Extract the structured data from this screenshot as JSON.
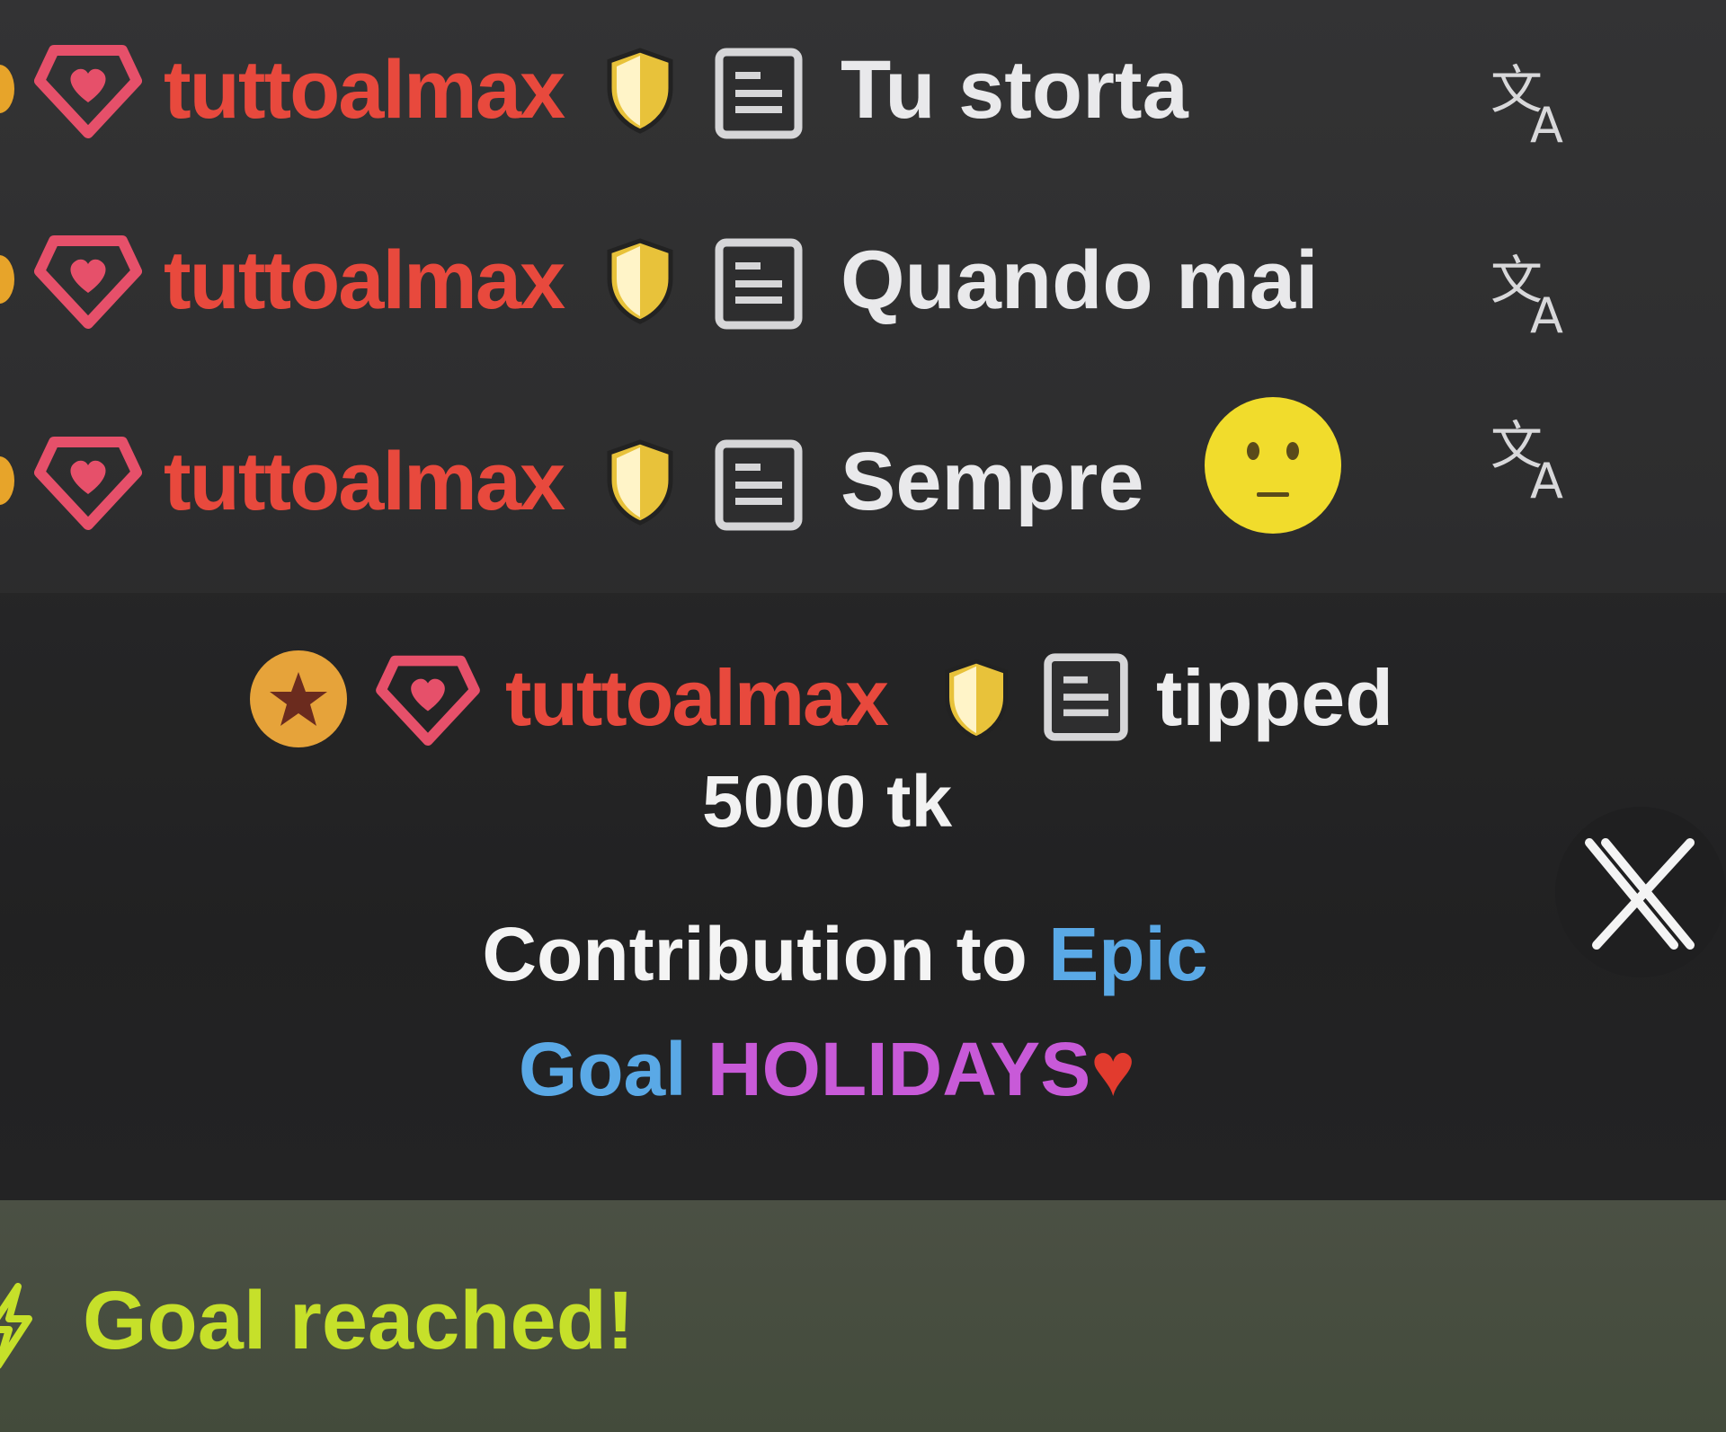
{
  "chat": {
    "messages": [
      {
        "username": "tuttoalmax",
        "text": "Tu storta",
        "translate_icon": "translate-icon"
      },
      {
        "username": "tuttoalmax",
        "text": "Quando mai",
        "translate_icon": "translate-icon"
      },
      {
        "username": "tuttoalmax",
        "text": "Sempre",
        "emoji": "neutral-face-emoji",
        "translate_icon": "translate-icon"
      }
    ]
  },
  "tip": {
    "username": "tuttoalmax",
    "verb": "tipped",
    "amount": "5000 tk",
    "line1_prefix": "Contribution to ",
    "line1_highlight": "Epic",
    "line2_blue": "Goal",
    "line2_purple": "HOLIDAYS",
    "line2_emoji": "♥"
  },
  "goal": {
    "text": "Goal reached!"
  },
  "colors": {
    "username": "#e8493d",
    "message": "#e9e9eb",
    "badge_pink": "#e6506a",
    "shield_yellow": "#e8c23a",
    "goal_text": "#c6e02a",
    "link_blue": "#5aa9e6",
    "holiday_purple": "#c85ad8",
    "heart_red": "#e23b2e",
    "star_badge": "#e6a33a"
  }
}
